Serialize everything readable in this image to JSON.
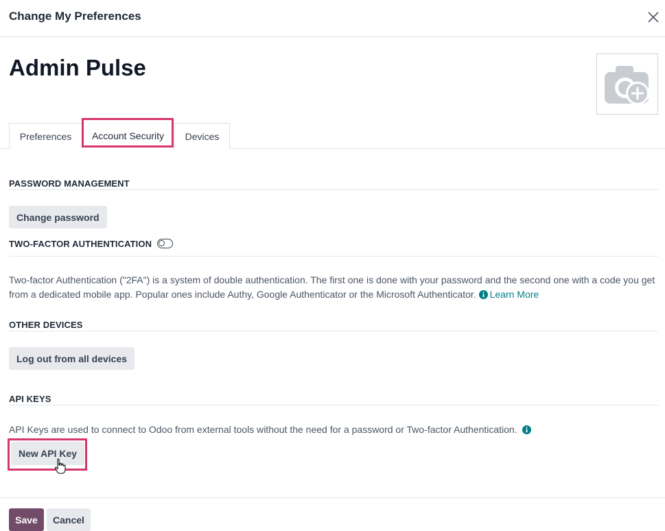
{
  "dialog": {
    "title": "Change My Preferences",
    "close_icon": "close-icon"
  },
  "user": {
    "name": "Admin Pulse",
    "avatar_icon": "camera-plus-icon"
  },
  "tabs": [
    {
      "label": "Preferences",
      "active": false
    },
    {
      "label": "Account Security",
      "active": true
    },
    {
      "label": "Devices",
      "active": false
    }
  ],
  "password_management": {
    "title": "PASSWORD MANAGEMENT",
    "change_password_label": "Change password"
  },
  "two_factor": {
    "title": "TWO-FACTOR AUTHENTICATION",
    "enabled": false,
    "description": "Two-factor Authentication (\"2FA\") is a system of double authentication. The first one is done with your password and the second one with a code you get from a dedicated mobile app. Popular ones include Authy, Google Authenticator or the Microsoft Authenticator.",
    "learn_more_label": "Learn More"
  },
  "other_devices": {
    "title": "OTHER DEVICES",
    "logout_label": "Log out from all devices"
  },
  "api_keys": {
    "title": "API KEYS",
    "description": "API Keys are used to connect to Odoo from external tools without the need for a password or Two-factor Authentication.",
    "new_key_label": "New API Key"
  },
  "footer": {
    "save_label": "Save",
    "cancel_label": "Cancel"
  },
  "colors": {
    "primary": "#714b67",
    "link": "#017e84",
    "highlight": "#d6366a"
  }
}
